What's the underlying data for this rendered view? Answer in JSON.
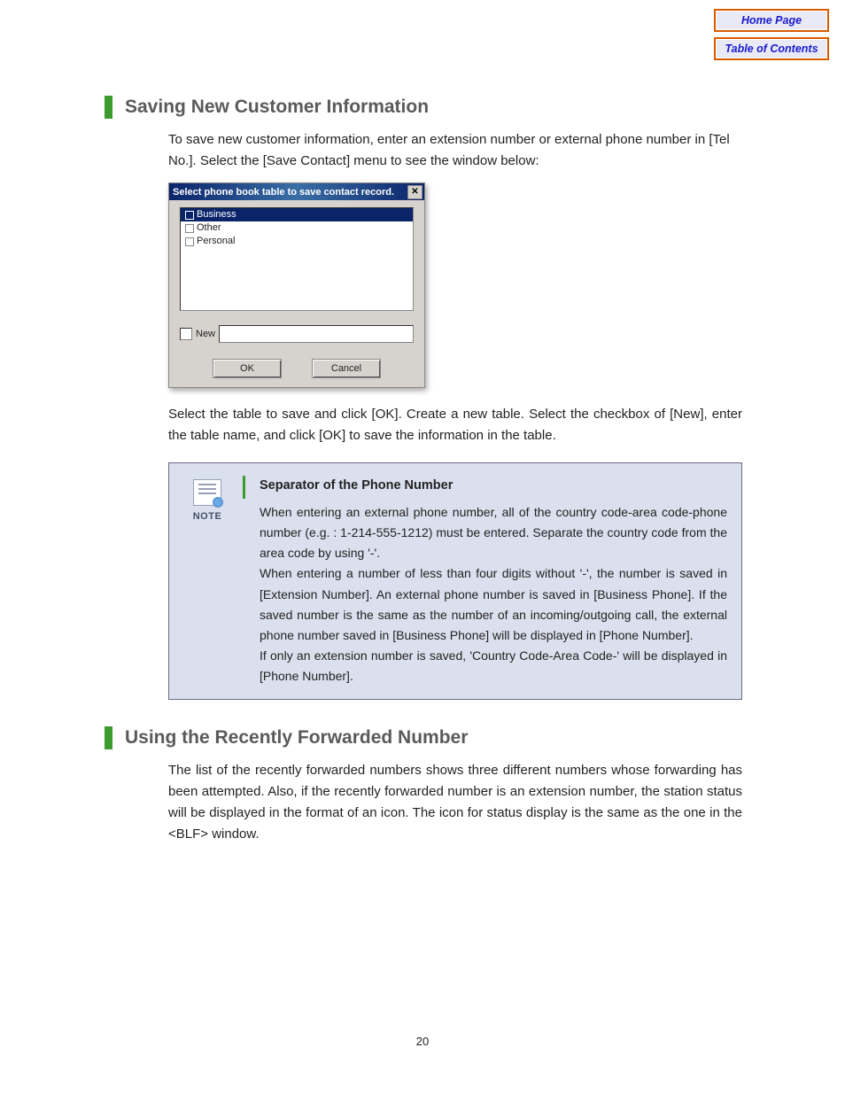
{
  "nav": {
    "home": "Home Page",
    "toc": "Table of Contents"
  },
  "section1": {
    "title": "Saving New Customer Information",
    "intro": "To save new customer information, enter an extension number or external phone number in [Tel No.]. Select the [Save Contact] menu to see the window below:",
    "after_dialog": "Select the table to save and click [OK]. Create a new table. Select the checkbox of [New], enter the table name, and click [OK] to save the information in the table."
  },
  "dialog": {
    "title": "Select phone book table to save contact record.",
    "items": [
      "Business",
      "Other",
      "Personal"
    ],
    "new_label": "New",
    "ok": "OK",
    "cancel": "Cancel"
  },
  "note": {
    "label": "NOTE",
    "heading": "Separator of the Phone Number",
    "p1": "When entering an external phone number, all of the country code-area code-phone number (e.g. : 1-214-555-1212) must be entered. Separate the country code from the area code by using '-'.",
    "p2": "When entering a number of less than four digits without '-', the number is saved in [Extension Number]. An external phone number is saved in [Business Phone]. If the saved number is the same as the number of an incoming/outgoing call, the external phone number saved in [Business Phone] will be displayed in [Phone Number].",
    "p3": "If only an extension number is saved, 'Country Code-Area Code-' will be displayed in [Phone Number]."
  },
  "section2": {
    "title": "Using the Recently Forwarded Number",
    "body": "The list of the recently forwarded numbers shows three different numbers whose forwarding has been attempted. Also, if the recently forwarded number is an extension number, the station status will be displayed in the format of an icon. The icon for status display is the same as the one in the <BLF> window."
  },
  "page_number": "20"
}
